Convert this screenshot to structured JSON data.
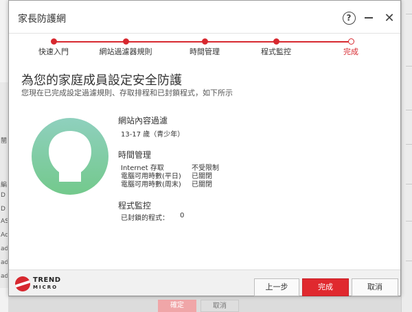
{
  "dialog": {
    "title": "家長防護網"
  },
  "window_buttons": {
    "help": "?",
    "close": "✕"
  },
  "steps": [
    {
      "label": "快速入門",
      "current": false
    },
    {
      "label": "網站過濾器規則",
      "current": false
    },
    {
      "label": "時間管理",
      "current": false
    },
    {
      "label": "程式監控",
      "current": false
    },
    {
      "label": "完成",
      "current": true
    }
  ],
  "content": {
    "heading": "為您的家庭成員設定安全防護",
    "subheading": "您現在已完成設定過濾規則、存取排程和已封鎖程式，如下所示"
  },
  "summary": {
    "web_filter": {
      "title": "網站內容過濾",
      "value": "13-17 歲（青少年）"
    },
    "time": {
      "title": "時間管理",
      "rows": [
        {
          "label": "Internet 存取",
          "value": "不受限制"
        },
        {
          "label": "電腦可用時數(平日)",
          "value": "已關閉"
        },
        {
          "label": "電腦可用時數(周末)",
          "value": "已關閉"
        }
      ]
    },
    "programs": {
      "title": "程式監控",
      "label": "已封鎖的程式：",
      "value": "0"
    }
  },
  "footer": {
    "logo_line1": "TREND",
    "logo_line2": "MICRO",
    "back_label": "上一步",
    "finish_label": "完成",
    "cancel_label": "取消"
  },
  "background": {
    "left_fragments": [
      "闉",
      "編",
      "D",
      "D",
      "AS",
      "Ac",
      "ad",
      "ad",
      "ad"
    ],
    "confirm_label": "確定",
    "cancel_label": "取消"
  },
  "colors": {
    "accent": "#d7282f",
    "avatar_top": "#8fd0be",
    "avatar_bottom": "#73c98c"
  }
}
